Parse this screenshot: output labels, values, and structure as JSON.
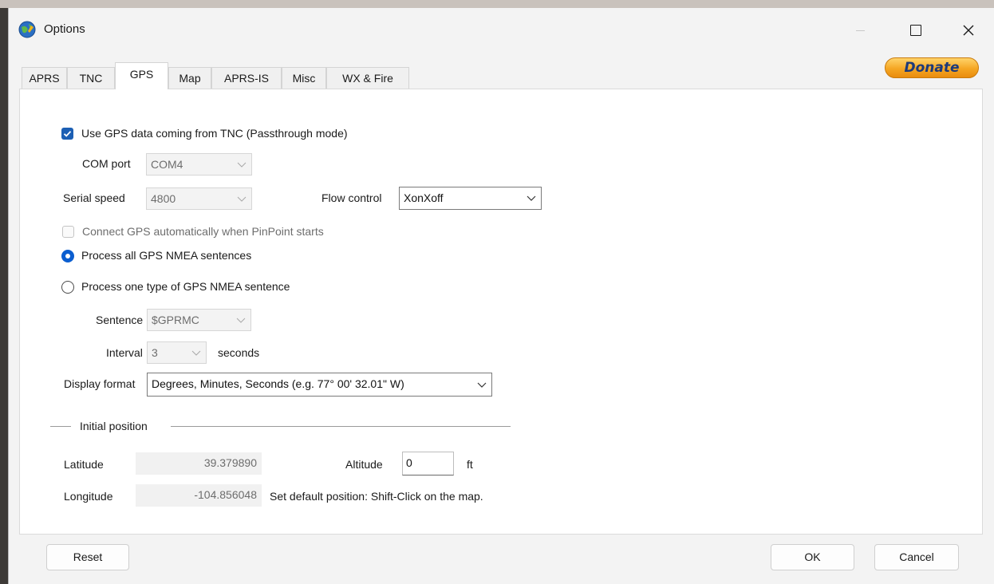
{
  "window": {
    "title": "Options",
    "icon": "app-globe-icon",
    "controls": [
      "minimize-icon",
      "maximize-icon",
      "close-icon"
    ]
  },
  "tabs": [
    {
      "label": "APRS",
      "active": false
    },
    {
      "label": "TNC",
      "active": false
    },
    {
      "label": "GPS",
      "active": true
    },
    {
      "label": "Map",
      "active": false
    },
    {
      "label": "APRS-IS",
      "active": false
    },
    {
      "label": "Misc",
      "active": false
    },
    {
      "label": "WX & Fire",
      "active": false
    }
  ],
  "donate_label": "Donate",
  "gps": {
    "passthrough": {
      "label": "Use GPS data coming from TNC (Passthrough mode)",
      "checked": true
    },
    "com_port": {
      "label": "COM port",
      "value": "COM4"
    },
    "serial_speed": {
      "label": "Serial speed",
      "value": "4800"
    },
    "flow_control": {
      "label": "Flow control",
      "value": "XonXoff"
    },
    "auto_connect": {
      "label": "Connect GPS automatically when PinPoint starts",
      "checked": false
    },
    "process_all": {
      "label": "Process all GPS NMEA sentences",
      "selected": true
    },
    "process_one": {
      "label": "Process one type of GPS NMEA sentence",
      "selected": false
    },
    "sentence": {
      "label": "Sentence",
      "value": "$GPRMC"
    },
    "interval": {
      "label": "Interval",
      "value": "3",
      "unit": "seconds"
    },
    "display_format": {
      "label": "Display format",
      "value": "Degrees, Minutes, Seconds (e.g. 77° 00' 32.01\" W)"
    }
  },
  "initial_position": {
    "title": "Initial position",
    "latitude": {
      "label": "Latitude",
      "value": "39.379890"
    },
    "longitude": {
      "label": "Longitude",
      "value": "-104.856048"
    },
    "altitude": {
      "label": "Altitude",
      "value": "0",
      "unit": "ft"
    },
    "hint": "Set default position: Shift-Click on the map."
  },
  "footer": {
    "reset": "Reset",
    "ok": "OK",
    "cancel": "Cancel"
  },
  "colors": {
    "accent": "#0b5ed0",
    "donate": "#f5a623",
    "donate_text": "#1d3a7a"
  }
}
